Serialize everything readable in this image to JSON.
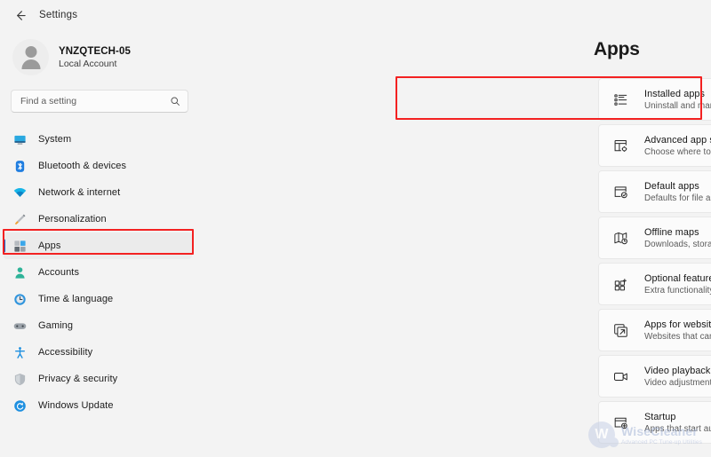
{
  "titlebar": {
    "back_icon": "back-arrow-icon",
    "title": "Settings"
  },
  "sidebar": {
    "account": {
      "avatar_icon": "user-avatar-icon",
      "name": "YNZQTECH-05",
      "type": "Local Account"
    },
    "search": {
      "placeholder": "Find a setting",
      "value": "",
      "icon": "search-icon"
    },
    "items": [
      {
        "label": "System",
        "icon": "monitor-icon",
        "selected": false
      },
      {
        "label": "Bluetooth & devices",
        "icon": "bluetooth-icon",
        "selected": false
      },
      {
        "label": "Network & internet",
        "icon": "wifi-icon",
        "selected": false
      },
      {
        "label": "Personalization",
        "icon": "paintbrush-icon",
        "selected": false
      },
      {
        "label": "Apps",
        "icon": "apps-grid-icon",
        "selected": true
      },
      {
        "label": "Accounts",
        "icon": "person-icon",
        "selected": false
      },
      {
        "label": "Time & language",
        "icon": "clock-globe-icon",
        "selected": false
      },
      {
        "label": "Gaming",
        "icon": "gamepad-icon",
        "selected": false
      },
      {
        "label": "Accessibility",
        "icon": "accessibility-person-icon",
        "selected": false
      },
      {
        "label": "Privacy & security",
        "icon": "shield-icon",
        "selected": false
      },
      {
        "label": "Windows Update",
        "icon": "update-refresh-icon",
        "selected": false
      }
    ]
  },
  "main": {
    "page_title": "Apps",
    "cards": [
      {
        "title": "Installed apps",
        "subtitle": "Uninstall and manage apps on your PC",
        "icon": "list-view-icon"
      },
      {
        "title": "Advanced app settings",
        "subtitle": "Choose where to get apps, archive apps, uninstall updates",
        "icon": "window-gear-icon"
      },
      {
        "title": "Default apps",
        "subtitle": "Defaults for file and link types, other defaults",
        "icon": "window-check-icon"
      },
      {
        "title": "Offline maps",
        "subtitle": "Downloads, storage location, map updates",
        "icon": "map-clock-icon"
      },
      {
        "title": "Optional features",
        "subtitle": "Extra functionality for your device",
        "icon": "grid-plus-icon"
      },
      {
        "title": "Apps for websites",
        "subtitle": "Websites that can open in an app instead of a browser",
        "icon": "external-link-icon"
      },
      {
        "title": "Video playback",
        "subtitle": "Video adjustments, HDR streaming, battery options",
        "icon": "video-camera-icon"
      },
      {
        "title": "Startup",
        "subtitle": "Apps that start automatically when you sign in",
        "icon": "window-plus-icon"
      }
    ]
  },
  "annotations": {
    "color": "#f32121",
    "highlighted": [
      "Apps",
      "Installed apps"
    ]
  },
  "watermark": {
    "badge_letter": "W",
    "name": "WiseCleaner",
    "tagline": "Advanced PC Tune-up Utilities"
  }
}
